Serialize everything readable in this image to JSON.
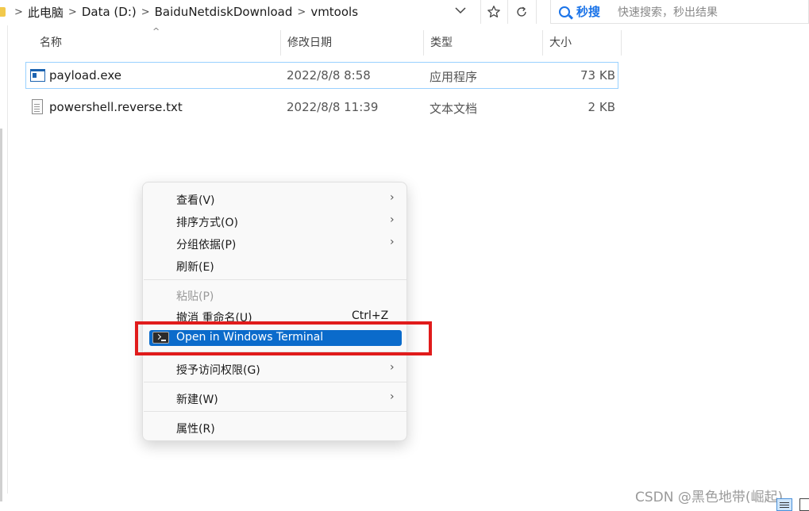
{
  "address_bar": {
    "separator": ">",
    "crumbs": [
      "此电脑",
      "Data (D:)",
      "BaiduNetdiskDownload",
      "vmtools"
    ]
  },
  "toolbar": {
    "dropdown_icon": "chevron-down-icon",
    "favorite_icon": "star-icon",
    "refresh_icon": "refresh-icon"
  },
  "search": {
    "brand": "秒搜",
    "placeholder": "快速搜索，秒出结果"
  },
  "columns": {
    "name": "名称",
    "modified": "修改日期",
    "type": "类型",
    "size": "大小",
    "sort_indicator": "^"
  },
  "files": [
    {
      "name": "payload.exe",
      "modified": "2022/8/8 8:58",
      "type": "应用程序",
      "size": "73 KB",
      "icon": "exe-icon",
      "selected": true
    },
    {
      "name": "powershell.reverse.txt",
      "modified": "2022/8/8 11:39",
      "type": "文本文档",
      "size": "2 KB",
      "icon": "text-file-icon",
      "selected": false
    }
  ],
  "context_menu": {
    "arrow": "›",
    "view": "查看(V)",
    "sort_by": "排序方式(O)",
    "group_by": "分组依据(P)",
    "refresh": "刷新(E)",
    "paste": "粘贴(P)",
    "undo_rename": "撤消 重命名(U)",
    "undo_shortcut": "Ctrl+Z",
    "open_terminal": "Open in Windows Terminal",
    "grant_access": "授予访问权限(G)",
    "new": "新建(W)",
    "properties": "属性(R)"
  },
  "annotation": {
    "highlight_color": "#e01b1b"
  },
  "watermark": "CSDN @黑色地带(崛起)",
  "colors": {
    "accent": "#0b6bcb",
    "search_brand": "#1a73e8",
    "selection_border": "#99d1ff"
  }
}
